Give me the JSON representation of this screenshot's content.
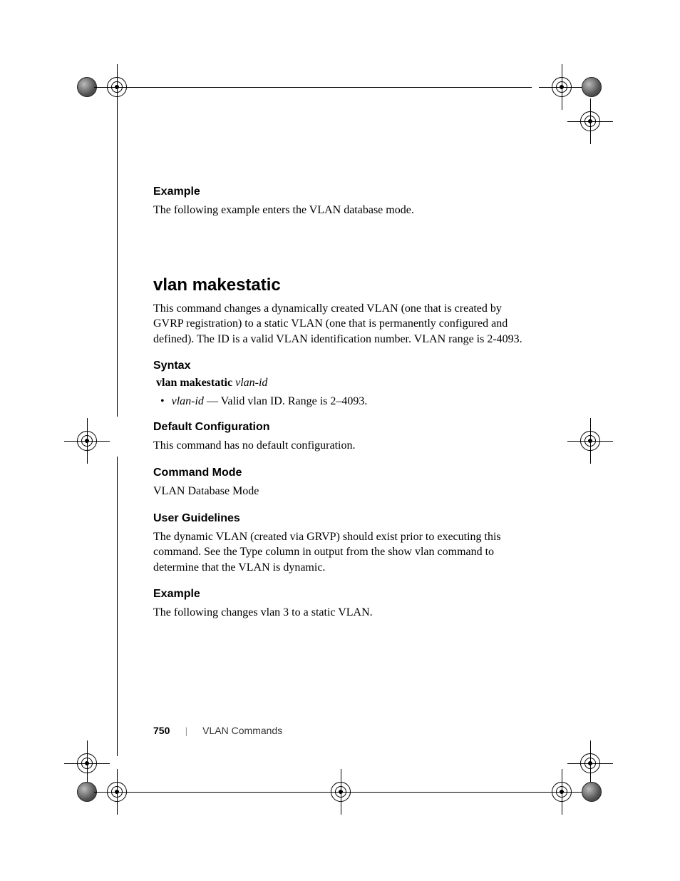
{
  "section1": {
    "heading": "Example",
    "body": "The following example enters the VLAN database mode."
  },
  "command": {
    "title": "vlan makestatic",
    "description": "This command changes a dynamically created VLAN (one that is created by GVRP registration) to a static VLAN (one that is permanently configured and defined). The ID is a valid VLAN identification number. VLAN range is 2-4093."
  },
  "syntax": {
    "heading": "Syntax",
    "cmd_bold": "vlan makestatic",
    "cmd_italic": "vlan-id",
    "bullet_italic": "vlan-id",
    "bullet_rest": " — Valid vlan ID. Range is 2–4093."
  },
  "default_config": {
    "heading": "Default Configuration",
    "body": "This command has no default configuration."
  },
  "command_mode": {
    "heading": "Command Mode",
    "body": "VLAN Database Mode"
  },
  "user_guidelines": {
    "heading": "User Guidelines",
    "body": "The dynamic VLAN (created via GRVP) should exist prior to executing this command. See the Type column in output from the show vlan command to determine that the VLAN is dynamic."
  },
  "example2": {
    "heading": "Example",
    "body": "The following changes vlan 3 to a static VLAN."
  },
  "footer": {
    "page": "750",
    "chapter": "VLAN Commands"
  }
}
